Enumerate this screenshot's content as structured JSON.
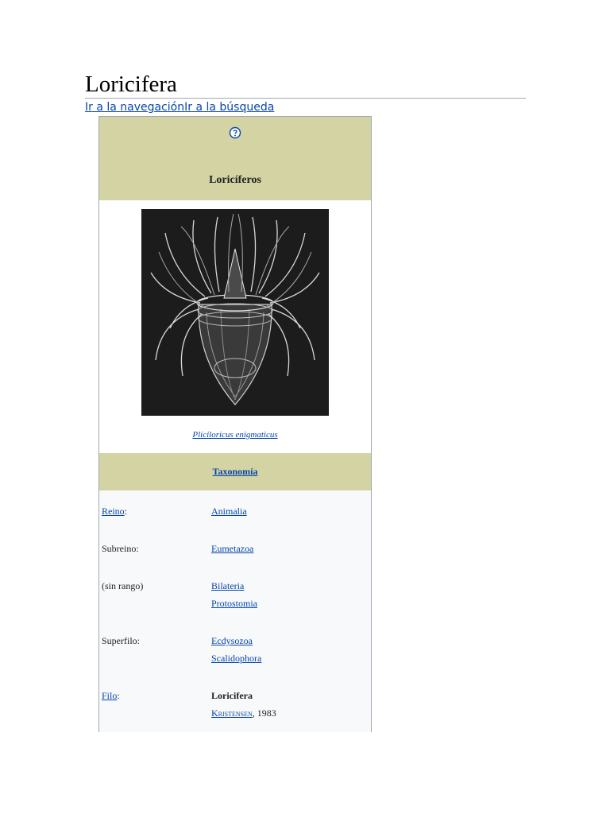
{
  "page": {
    "title": "Loricifera",
    "jump_links": {
      "nav": "Ir a la navegación",
      "search": "Ir a la búsqueda"
    }
  },
  "infobox": {
    "help_icon": "question-mark-circle-icon",
    "title": "Loricíferos",
    "image_caption": "Pliciloricus enigmaticus",
    "taxonomy_header": "Taxonomía",
    "rows": {
      "reino": {
        "label": "Reino",
        "value": "Animalia"
      },
      "subreino": {
        "label": "Subreino:",
        "value": "Eumetazoa"
      },
      "sin_rango": {
        "label": "(sin rango)",
        "values": [
          "Bilateria",
          "Protostomia"
        ]
      },
      "superfilo": {
        "label": "Superfilo:",
        "values": [
          "Ecdysozoa",
          "Scalidophora"
        ]
      },
      "filo": {
        "label": "Filo",
        "value": "Loricifera",
        "author": "Kristensen",
        "year": ", 1983"
      }
    }
  },
  "colors": {
    "header_bg": "#d3d3a4",
    "link": "#0645ad",
    "infobox_bg": "#f8f9fa",
    "border": "#a2a9b1"
  }
}
